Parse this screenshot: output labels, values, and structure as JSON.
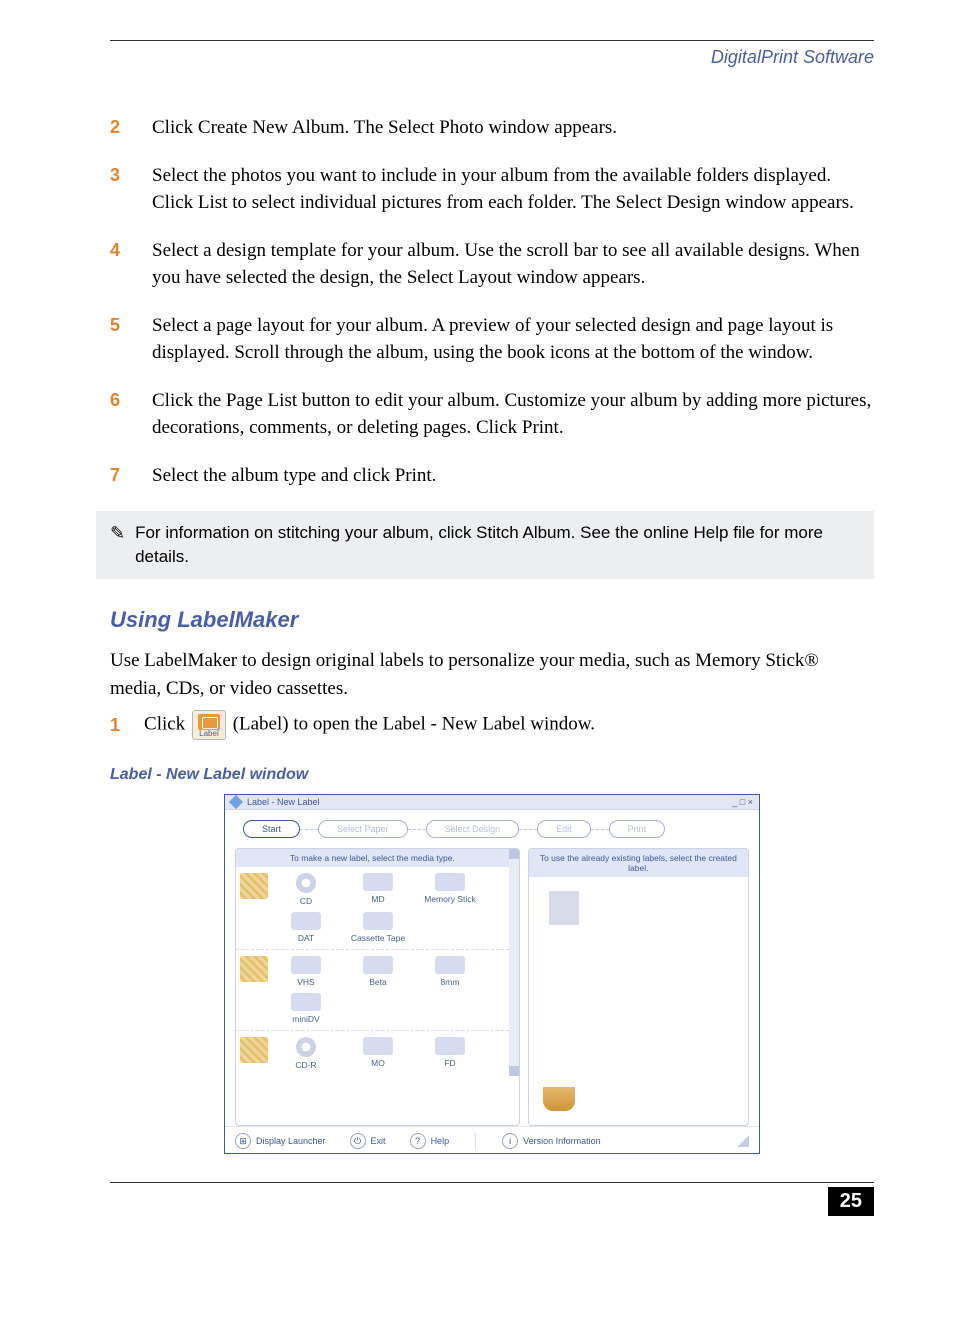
{
  "running_head": "DigitalPrint Software",
  "steps": [
    {
      "n": "2",
      "t": "Click Create New Album. The Select Photo window appears."
    },
    {
      "n": "3",
      "t": "Select the photos you want to include in your album from the available folders displayed. Click List to select individual pictures from each folder. The Select Design window appears."
    },
    {
      "n": "4",
      "t": "Select a design template for your album. Use the scroll bar to see all available designs. When you have selected the design, the Select Layout window appears."
    },
    {
      "n": "5",
      "t": "Select a page layout for your album. A preview of your selected design and page layout is displayed. Scroll through the album, using the book icons at the bottom of the window."
    },
    {
      "n": "6",
      "t": "Click the Page List button to edit your album. Customize your album by adding more pictures, decorations, comments, or deleting pages. Click Print."
    },
    {
      "n": "7",
      "t": "Select the album type and click Print."
    }
  ],
  "note_icon": "✎",
  "note_text": "For information on stitching your album, click Stitch Album. See the online Help file for more details.",
  "h2": "Using LabelMaker",
  "intro": "Use LabelMaker to design original labels to personalize your media, such as Memory Stick® media, CDs, or video cassettes.",
  "step1": {
    "n": "1",
    "pre": "Click",
    "chip": "Label",
    "post": "(Label) to open the Label - New Label window."
  },
  "fig_caption": "Label - New Label window",
  "shot": {
    "title": "Label - New Label",
    "win_buttons": "_  □  ×",
    "wizard": [
      "Start",
      "Select Paper",
      "Select Design",
      "Edit",
      "Print"
    ],
    "left_head": "To make a new label, select the media type.",
    "right_head": "To use the already existing labels, select the created label.",
    "groups": [
      {
        "items": [
          {
            "l": "CD",
            "shape": "disc"
          },
          {
            "l": "MD"
          },
          {
            "l": "Memory Stick"
          },
          {
            "l": "DAT"
          },
          {
            "l": "Cassette Tape"
          }
        ]
      },
      {
        "items": [
          {
            "l": "VHS"
          },
          {
            "l": "Beta"
          },
          {
            "l": "8mm"
          },
          {
            "l": "miniDV"
          }
        ]
      },
      {
        "items": [
          {
            "l": "CD-R",
            "shape": "disc"
          },
          {
            "l": "MO"
          },
          {
            "l": "FD"
          }
        ]
      }
    ],
    "status": {
      "launcher": "Display Launcher",
      "exit": "Exit",
      "help": "Help",
      "ver": "Version Information"
    }
  },
  "page_number": "25"
}
